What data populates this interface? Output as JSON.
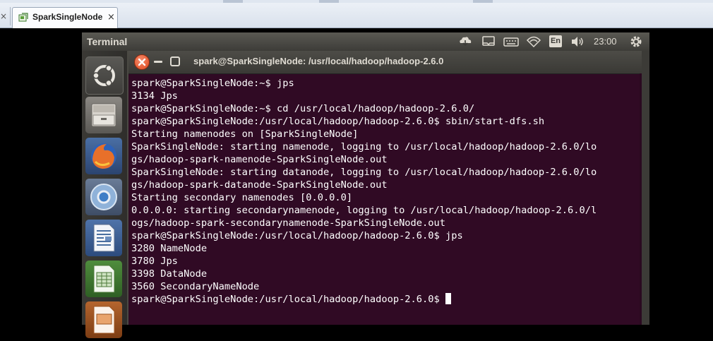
{
  "vbox": {
    "tab_active_label": "SparkSingleNode",
    "tab_prev_close": "×",
    "tab_close": "×"
  },
  "panel": {
    "app_title": "Terminal",
    "keyboard_layout": "En",
    "clock": "23:00"
  },
  "window": {
    "title": "spark@SparkSingleNode: /usr/local/hadoop/hadoop-2.6.0"
  },
  "terminal": {
    "lines": [
      "spark@SparkSingleNode:~$ jps",
      "3134 Jps",
      "spark@SparkSingleNode:~$ cd /usr/local/hadoop/hadoop-2.6.0/",
      "spark@SparkSingleNode:/usr/local/hadoop/hadoop-2.6.0$ sbin/start-dfs.sh",
      "Starting namenodes on [SparkSingleNode]",
      "SparkSingleNode: starting namenode, logging to /usr/local/hadoop/hadoop-2.6.0/lo",
      "gs/hadoop-spark-namenode-SparkSingleNode.out",
      "SparkSingleNode: starting datanode, logging to /usr/local/hadoop/hadoop-2.6.0/lo",
      "gs/hadoop-spark-datanode-SparkSingleNode.out",
      "Starting secondary namenodes [0.0.0.0]",
      "0.0.0.0: starting secondarynamenode, logging to /usr/local/hadoop/hadoop-2.6.0/l",
      "ogs/hadoop-spark-secondarynamenode-SparkSingleNode.out",
      "spark@SparkSingleNode:/usr/local/hadoop/hadoop-2.6.0$ jps",
      "3280 NameNode",
      "3780 Jps",
      "3398 DataNode",
      "3560 SecondaryNameNode"
    ],
    "prompt": "spark@SparkSingleNode:/usr/local/hadoop/hadoop-2.6.0$"
  },
  "launcher": {
    "items": [
      "ubuntu-dash-icon",
      "files-icon",
      "firefox-icon",
      "chromium-icon",
      "writer-icon",
      "calc-icon",
      "impress-icon"
    ]
  }
}
